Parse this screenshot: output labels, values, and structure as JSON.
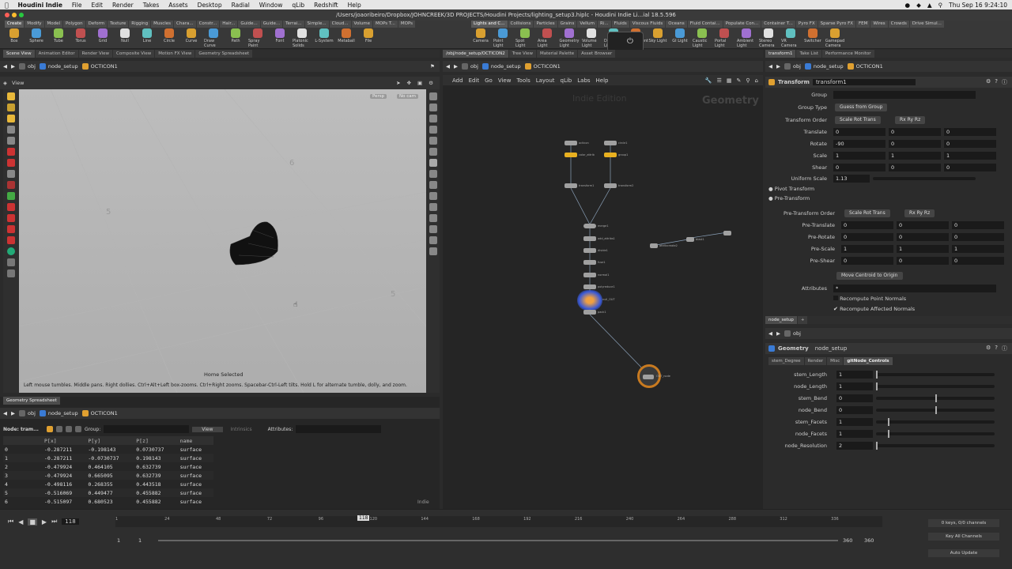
{
  "mac": {
    "app": "Houdini Indie",
    "menus": [
      "File",
      "Edit",
      "Render",
      "Takes",
      "Assets",
      "Desktop",
      "Radial",
      "Window",
      "qLib",
      "Redshift",
      "Help"
    ],
    "clock": "Thu Sep 16  9:24:10"
  },
  "window_title": "/Users/joaoribeiro/Dropbox/JOHNCREEK/3D PROJECTS/Houdini Projects/lighting_setup3.hiplc - Houdini Indie Li...ial 18.5.596",
  "shelf": {
    "left_tabs": [
      "Create",
      "Modify",
      "Model",
      "Polygon",
      "Deform",
      "Texture",
      "Rigging",
      "Muscles",
      "Chara...",
      "Constr...",
      "Hair...",
      "Guide...",
      "Guide...",
      "Terrai...",
      "Simple...",
      "Cloud...",
      "Volume",
      "MOPs T...",
      "MOPs"
    ],
    "left_tools": [
      "Box",
      "Sphere",
      "Tube",
      "Torus",
      "Grid",
      "Null",
      "Line",
      "Circle",
      "Curve",
      "Draw Curve",
      "Path",
      "Spray Paint",
      "Font",
      "Platonic Solids",
      "L-System",
      "Metaball",
      "File"
    ],
    "right_tabs": [
      "Lights and C...",
      "Collisions",
      "Particles",
      "Grains",
      "Vellum",
      "Ri...",
      "Fluids",
      "Viscous Fluids",
      "Oceans",
      "Fluid Contai...",
      "Populate Con...",
      "Container T...",
      "Pyro FX",
      "Sparse Pyro FX",
      "FEM",
      "Wires",
      "Crowds",
      "Drive Simul..."
    ],
    "right_tools": [
      "Camera",
      "Point Light",
      "Spot Light",
      "Area Light",
      "Geometry Light",
      "Volume Light",
      "Distant Light",
      "Environment Light",
      "Sky Light",
      "GI Light",
      "Caustic Light",
      "Portal Light",
      "Ambient Light",
      "Stereo Camera",
      "VR Camera",
      "Switcher",
      "Gamepad Camera"
    ]
  },
  "left_pane": {
    "tabs": [
      "Scene View",
      "Animation Editor",
      "Render View",
      "Composite View",
      "Motion FX View",
      "Geometry Spreadsheet"
    ],
    "path": [
      "obj",
      "node_setup",
      "OCTICON1"
    ],
    "view_label": "View",
    "persp": "Persp",
    "nocam": "No cam",
    "status": "Home Selected",
    "hint": "Left mouse tumbles. Middle pans. Right dollies. Ctrl+Alt+Left box-zooms. Ctrl+Right zooms. Spacebar-Ctrl-Left tilts. Hold L for alternate tumble, dolly, and zoom.",
    "grid_labels": [
      "6",
      "5",
      "5"
    ]
  },
  "spreadsheet": {
    "tab": "Geometry Spreadsheet",
    "path": [
      "obj",
      "node_setup",
      "OCTICON1"
    ],
    "node_label": "Node: tram...",
    "group_label": "Group:",
    "view_btn": "View",
    "intrinsics": "Intrinsics",
    "attributes_label": "Attributes:",
    "columns": [
      "",
      "P[x]",
      "P[y]",
      "P[z]",
      "name"
    ],
    "rows": [
      [
        "0",
        "-0.287211",
        "-0.198143",
        "0.0730737",
        "surface"
      ],
      [
        "1",
        "-0.287211",
        "-0.0730737",
        "0.198143",
        "surface"
      ],
      [
        "2",
        "-0.479924",
        "0.464105",
        "0.632739",
        "surface"
      ],
      [
        "3",
        "-0.479924",
        "0.665095",
        "0.632739",
        "surface"
      ],
      [
        "4",
        "-0.498116",
        "0.268355",
        "0.443518",
        "surface"
      ],
      [
        "5",
        "-0.516069",
        "0.449477",
        "0.455882",
        "surface"
      ],
      [
        "6",
        "-0.515097",
        "0.680523",
        "0.455882",
        "surface"
      ]
    ],
    "mode": "Indie"
  },
  "network": {
    "tabs": [
      "/obj/node_setup/OCTICON2",
      "Tree View",
      "Material Palette",
      "Asset Browser"
    ],
    "path": [
      "obj",
      "node_setup",
      "OCTICON1"
    ],
    "menus": [
      "Add",
      "Edit",
      "Go",
      "View",
      "Tools",
      "Layout",
      "qLib",
      "Labs",
      "Help"
    ],
    "watermark": "Indie Edition",
    "context": "Geometry",
    "nodes": [
      "octicon",
      "color_attrib",
      "transform1",
      "merge1",
      "add_attribs1",
      "divide1",
      "fuse1",
      "normal1",
      "polyreduce1",
      "transform2",
      "null_OUT",
      "OUT_node",
      "attribcreate2",
      "blast1",
      "group1",
      "pack1",
      "circle1"
    ]
  },
  "params": {
    "tabs": [
      "transform1",
      "Take List",
      "Performance Monitor"
    ],
    "path": [
      "obj",
      "node_setup",
      "OCTICON1"
    ],
    "node_type": "Transform",
    "node_name": "transform1",
    "group_label": "Group",
    "group_type_label": "Group Type",
    "group_type": "Guess from Group",
    "transform_order_label": "Transform Order",
    "transform_order": "Scale Rot Trans",
    "rot_order": "Rx Ry Rz",
    "translate_label": "Translate",
    "translate": [
      "0",
      "0",
      "0"
    ],
    "rotate_label": "Rotate",
    "rotate": [
      "-90",
      "0",
      "0"
    ],
    "scale_label": "Scale",
    "scale": [
      "1",
      "1",
      "1"
    ],
    "shear_label": "Shear",
    "shear": [
      "0",
      "0",
      "0"
    ],
    "uniform_scale_label": "Uniform Scale",
    "uniform_scale": "1.13",
    "pivot_transform": "Pivot Transform",
    "pre_transform": "Pre-Transform",
    "pre_transform_order_label": "Pre-Transform Order",
    "pre_transform_order": "Scale Rot Trans",
    "pre_rot_order": "Rx Ry Rz",
    "pre_translate_label": "Pre-Translate",
    "pre_translate": [
      "0",
      "0",
      "0"
    ],
    "pre_rotate_label": "Pre-Rotate",
    "pre_rotate": [
      "0",
      "0",
      "0"
    ],
    "pre_scale_label": "Pre-Scale",
    "pre_scale": [
      "1",
      "1",
      "1"
    ],
    "pre_shear_label": "Pre-Shear",
    "pre_shear": [
      "0",
      "0",
      "0"
    ],
    "move_centroid": "Move Centroid to Origin",
    "attributes_label": "Attributes",
    "attributes_value": "*",
    "recompute_point_normals": "Recompute Point Normals",
    "recompute_affected_normals": "Recompute Affected Normals"
  },
  "params2": {
    "tab": "node_setup",
    "path": [
      "obj"
    ],
    "node_type": "Geometry",
    "node_name": "node_setup",
    "tabs": [
      "stem_Degree",
      "Render",
      "Misc",
      "gitNode_Controls"
    ],
    "controls": [
      {
        "label": "stem_Length",
        "value": "1",
        "frac": 0.0
      },
      {
        "label": "node_Length",
        "value": "1",
        "frac": 0.0
      },
      {
        "label": "stem_Bend",
        "value": "0",
        "frac": 0.5
      },
      {
        "label": "node_Bend",
        "value": "0",
        "frac": 0.5
      },
      {
        "label": "stem_Facets",
        "value": "1",
        "frac": 0.1
      },
      {
        "label": "node_Facets",
        "value": "1",
        "frac": 0.1
      },
      {
        "label": "node_Resolution",
        "value": "2",
        "frac": 0.0
      }
    ]
  },
  "timeline": {
    "frame": "118",
    "start": "1",
    "start2": "1",
    "end": "360",
    "end2": "360",
    "ticks": [
      "1",
      "24",
      "48",
      "72",
      "96",
      "120",
      "144",
      "168",
      "192",
      "216",
      "240",
      "264",
      "288",
      "312",
      "336"
    ],
    "keys": "0 keys, 0/0 channels",
    "key_all": "Key All Channels",
    "auto_update": "Auto Update"
  }
}
